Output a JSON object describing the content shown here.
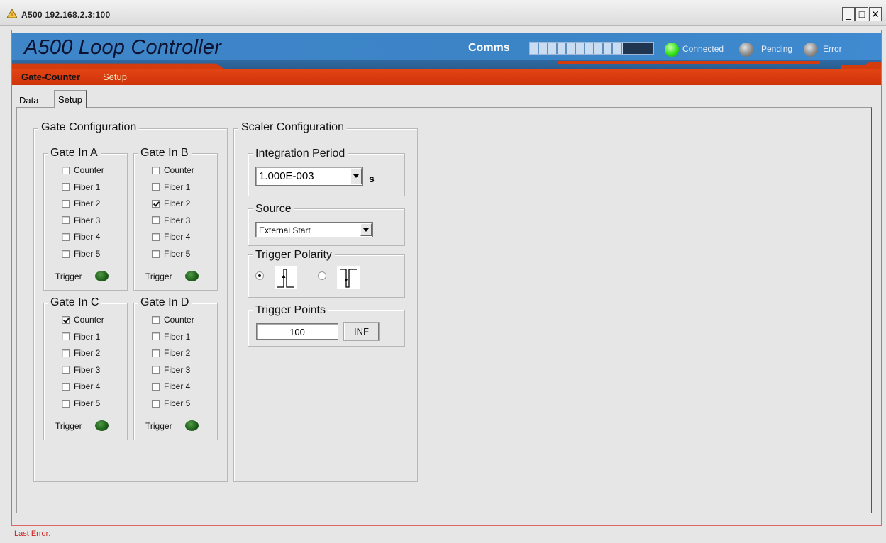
{
  "window": {
    "title": "A500 192.168.2.3:100",
    "icon": "warning-triangle-icon",
    "controls": {
      "minimize": "_",
      "maximize": "□",
      "close": "✕"
    }
  },
  "header": {
    "app_title": "A500 Loop Controller",
    "comms_label": "Comms",
    "comms_progress": 0.75,
    "status": [
      {
        "label": "Connected",
        "state": "on",
        "color": "#35e41a"
      },
      {
        "label": "Pending",
        "state": "off",
        "color": "#8d8d8d"
      },
      {
        "label": "Error",
        "state": "off",
        "color": "#8d8d8d"
      }
    ]
  },
  "nav": {
    "items": [
      "Gate-Counter",
      "Setup"
    ],
    "active": "Gate-Counter"
  },
  "tabs": {
    "items": [
      "Data",
      "Setup"
    ],
    "active": "Setup"
  },
  "gate_config": {
    "title": "Gate Configuration",
    "gates": [
      {
        "title": "Gate In A",
        "options": [
          "Counter",
          "Fiber 1",
          "Fiber 2",
          "Fiber 3",
          "Fiber 4",
          "Fiber 5"
        ],
        "checked": [
          false,
          false,
          false,
          false,
          false,
          false
        ],
        "trigger_label": "Trigger"
      },
      {
        "title": "Gate In B",
        "options": [
          "Counter",
          "Fiber 1",
          "Fiber 2",
          "Fiber 3",
          "Fiber 4",
          "Fiber 5"
        ],
        "checked": [
          false,
          false,
          true,
          false,
          false,
          false
        ],
        "trigger_label": "Trigger"
      },
      {
        "title": "Gate In C",
        "options": [
          "Counter",
          "Fiber 1",
          "Fiber 2",
          "Fiber 3",
          "Fiber 4",
          "Fiber 5"
        ],
        "checked": [
          true,
          false,
          false,
          false,
          false,
          false
        ],
        "trigger_label": "Trigger"
      },
      {
        "title": "Gate In D",
        "options": [
          "Counter",
          "Fiber 1",
          "Fiber 2",
          "Fiber 3",
          "Fiber 4",
          "Fiber 5"
        ],
        "checked": [
          false,
          false,
          false,
          false,
          false,
          false
        ],
        "trigger_label": "Trigger"
      }
    ]
  },
  "scaler_config": {
    "title": "Scaler Configuration",
    "integration_period": {
      "title": "Integration Period",
      "value": "1.000E-003",
      "unit": "s"
    },
    "source": {
      "title": "Source",
      "value": "External Start"
    },
    "trigger_polarity": {
      "title": "Trigger Polarity",
      "options": [
        "rising-edge",
        "falling-edge"
      ],
      "selected": "rising-edge"
    },
    "trigger_points": {
      "title": "Trigger Points",
      "value": "100",
      "button_label": "INF"
    }
  },
  "footer": {
    "last_error_label": "Last Error:"
  }
}
